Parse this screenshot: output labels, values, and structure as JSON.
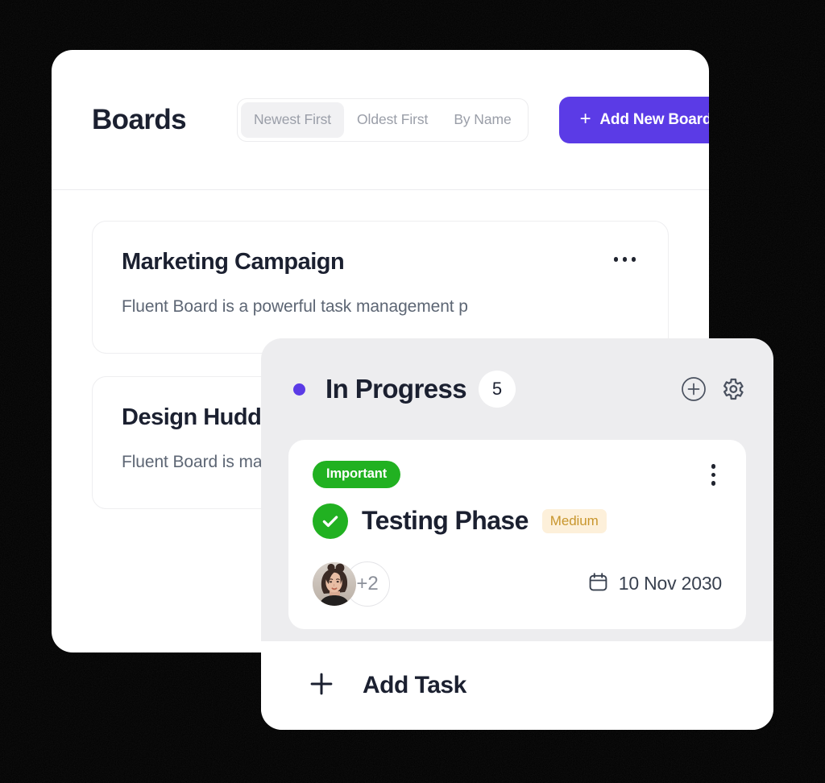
{
  "window": {
    "title": "Boards"
  },
  "header": {
    "title": "Boards",
    "sort_options": [
      {
        "label": "Newest First",
        "selected": true
      },
      {
        "label": "Oldest First",
        "selected": false
      },
      {
        "label": "By Name",
        "selected": false
      }
    ],
    "add_board_button": {
      "label": "Add New Board",
      "icon": "plus-icon",
      "color": "#5B3BE6"
    }
  },
  "boards": [
    {
      "title": "Marketing Campaign",
      "description": "Fluent Board is a powerful task management p",
      "menu_icon": "ellipsis-horizontal-icon"
    },
    {
      "title": "Design Hudd",
      "description": "Fluent Board is management p",
      "menu_icon": "ellipsis-horizontal-icon"
    }
  ],
  "kanban": {
    "column": {
      "dot_color": "#5B3BE6",
      "title": "In Progress",
      "count": "5",
      "add_icon": "plus-circle-icon",
      "settings_icon": "gear-icon"
    },
    "task": {
      "tag": {
        "label": "Important",
        "color": "#21B121"
      },
      "menu_icon": "ellipsis-vertical-icon",
      "check_icon": "check-circle-icon",
      "check_color": "#21B121",
      "title": "Testing Phase",
      "priority": {
        "label": "Medium",
        "bg": "#FDF0DA",
        "fg": "#C8962D"
      },
      "assignees_overflow": "+2",
      "avatar": "user-avatar",
      "due_icon": "calendar-icon",
      "due_date": "10 Nov 2030"
    },
    "add_task": {
      "label": "Add Task",
      "icon": "plus-icon"
    }
  }
}
